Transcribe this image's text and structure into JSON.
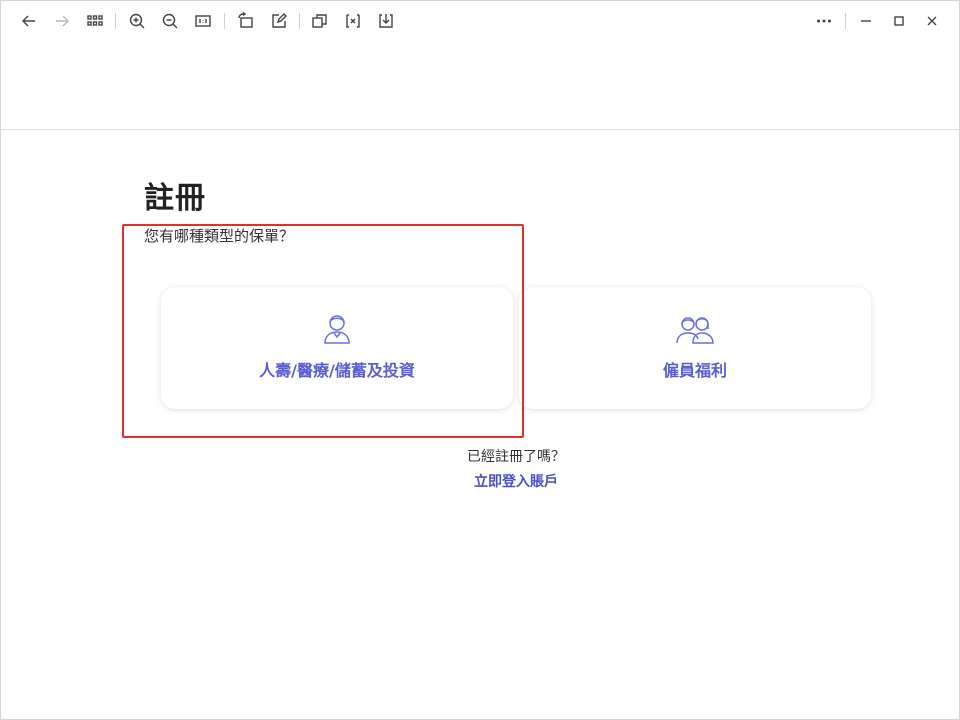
{
  "toolbar": {
    "icons": [
      "back-arrow-icon",
      "forward-arrow-icon",
      "grid-icon",
      "zoom-in-icon",
      "zoom-out-icon",
      "actual-size-icon",
      "rotate-icon",
      "edit-icon",
      "copy-icon",
      "formula-icon",
      "download-icon",
      "more-icon",
      "minimize-icon",
      "maximize-icon",
      "close-icon"
    ]
  },
  "page": {
    "title": "註冊",
    "subtitle": "您有哪種類型的保單？"
  },
  "cards": [
    {
      "label": "人壽/醫療/儲蓄及投資",
      "icon": "person-icon"
    },
    {
      "label": "僱員福利",
      "icon": "people-icon"
    }
  ],
  "footer": {
    "already_registered": "已經註冊了嗎？",
    "login_link": "立即登入賬戶"
  },
  "colors": {
    "accent": "#5b5fd6",
    "highlight": "#e0302a"
  }
}
